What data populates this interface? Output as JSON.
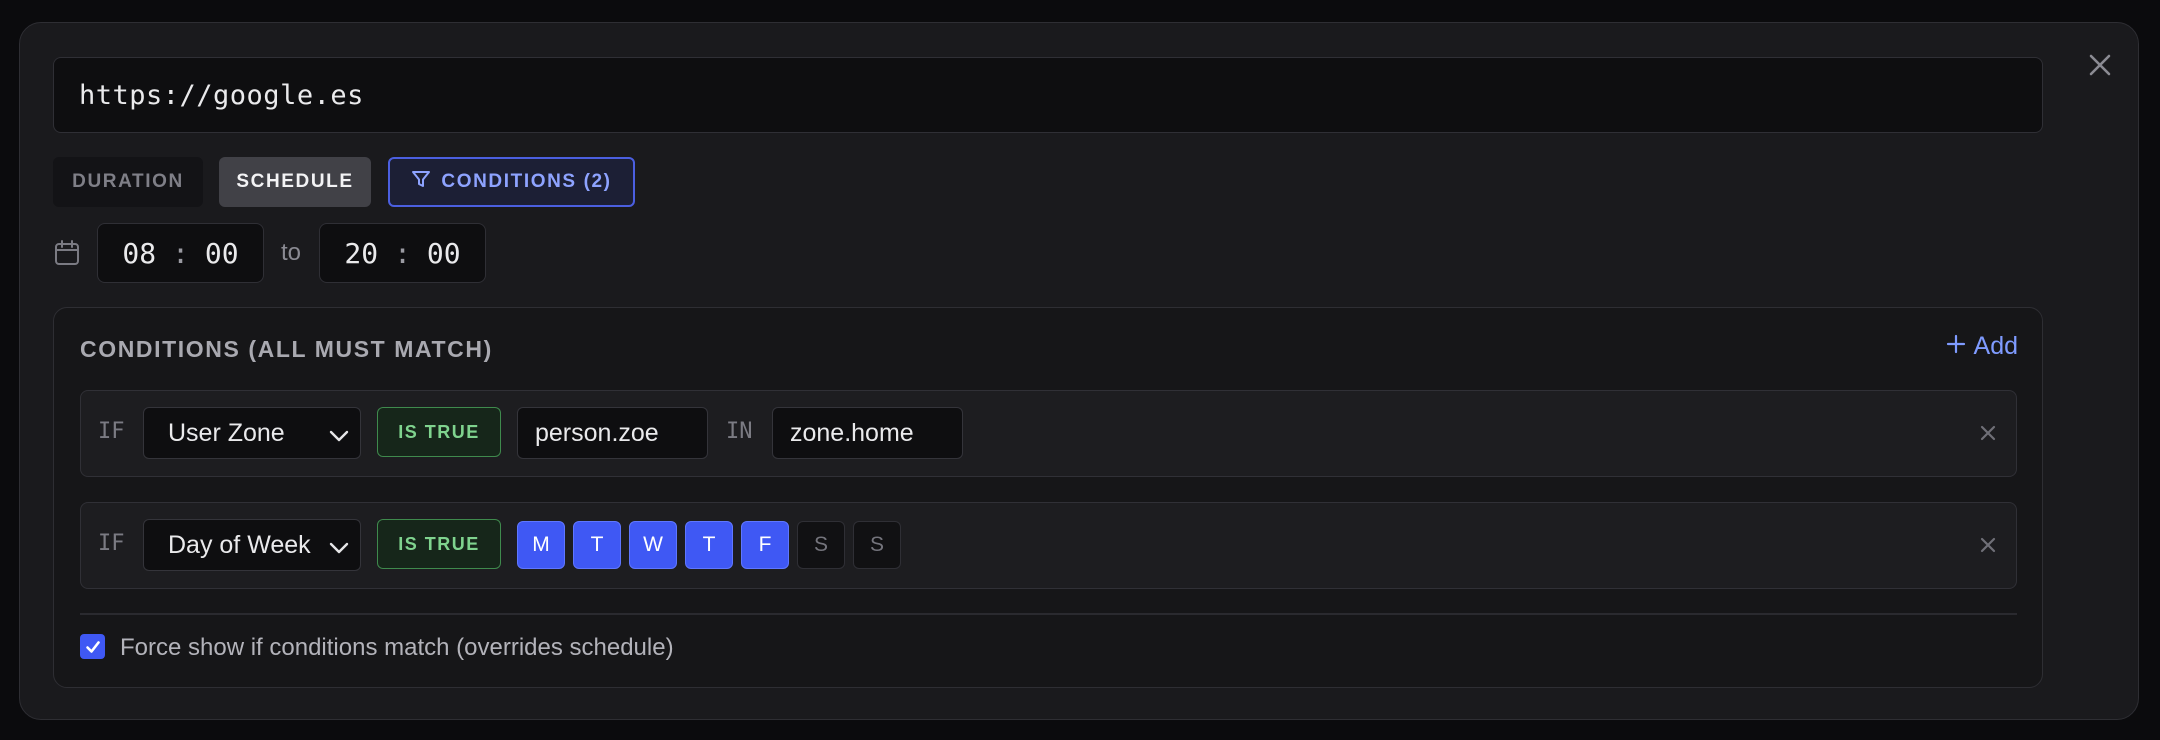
{
  "url": {
    "value": "https://google.es"
  },
  "tabs": {
    "duration": "DURATION",
    "schedule": "SCHEDULE",
    "conditions": "CONDITIONS (2)"
  },
  "schedule": {
    "from_hour": "08",
    "from_minute": "00",
    "separator": ":",
    "to_label": "to",
    "to_hour": "20",
    "to_minute": "00"
  },
  "conditions_panel": {
    "title": "CONDITIONS (ALL MUST MATCH)",
    "add_label": "Add",
    "rows": [
      {
        "if_label": "IF",
        "type": "User Zone",
        "operator": "IS TRUE",
        "entity": "person.zoe",
        "in_label": "IN",
        "zone": "zone.home"
      },
      {
        "if_label": "IF",
        "type": "Day of Week",
        "operator": "IS TRUE",
        "days": [
          {
            "label": "M",
            "selected": true
          },
          {
            "label": "T",
            "selected": true
          },
          {
            "label": "W",
            "selected": true
          },
          {
            "label": "T",
            "selected": true
          },
          {
            "label": "F",
            "selected": true
          },
          {
            "label": "S",
            "selected": false
          },
          {
            "label": "S",
            "selected": false
          }
        ]
      }
    ],
    "force_show": {
      "checked": true,
      "label": "Force show if conditions match (overrides schedule)"
    }
  },
  "colors": {
    "accent": "#3f58f4",
    "accent_text": "#7f9bff",
    "success": "#7fd38e",
    "background": "#1a1a1d"
  },
  "icons": {
    "close": "close-icon",
    "filter": "filter-icon",
    "calendar": "calendar-icon",
    "add": "plus-icon",
    "dropdown": "chevron-down-icon"
  }
}
